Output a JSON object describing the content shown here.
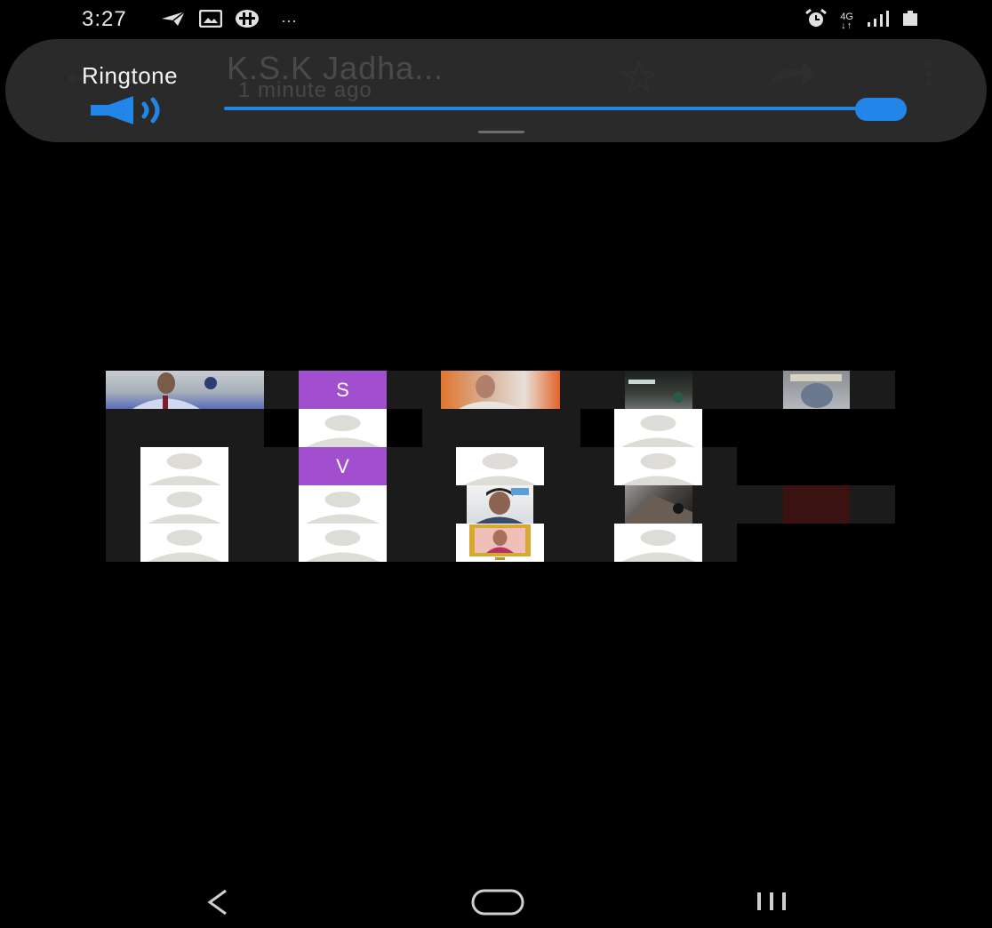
{
  "status_bar": {
    "time": "3:27",
    "ellipsis": "···",
    "network": "4G",
    "left_icons": [
      "telegram-icon",
      "gallery-icon",
      "app-icon"
    ],
    "right_icons": [
      "alarm-icon",
      "network-4g-icon",
      "signal-icon",
      "battery-icon"
    ]
  },
  "background_app": {
    "title": "K.S.K Jadha...",
    "subtitle": "1 minute ago",
    "icons": [
      "back-arrow-icon",
      "star-icon",
      "share-arrow-icon",
      "more-vert-icon"
    ]
  },
  "volume_panel": {
    "label": "Ringtone",
    "level_fraction": 1.0,
    "accent_color": "#2186e8",
    "icon": "speaker-icon"
  },
  "meeting_grid": {
    "initial_tiles": [
      "S",
      "V"
    ],
    "initial_tile_color": "#a24fcf",
    "video_tiles": 9,
    "avatar_tiles": 11
  },
  "nav_bar": {
    "icons": [
      "back-icon",
      "home-icon",
      "recents-icon"
    ]
  }
}
